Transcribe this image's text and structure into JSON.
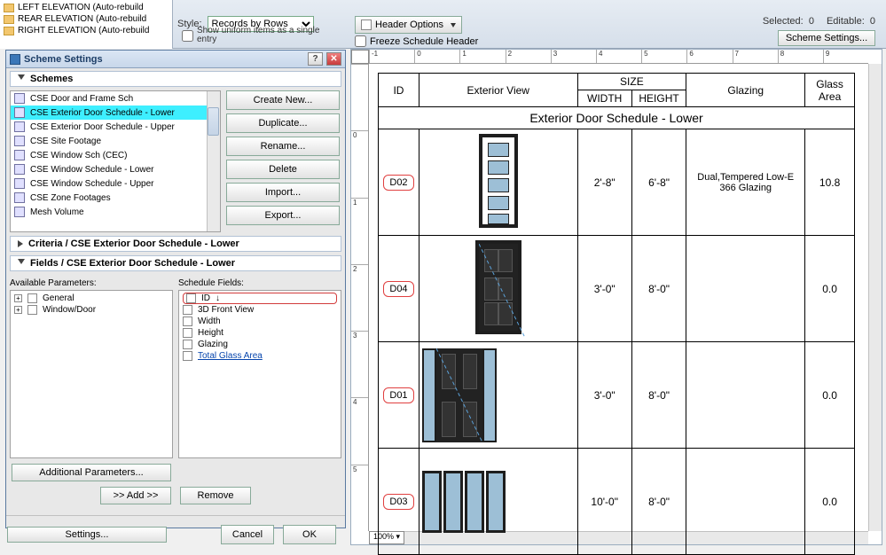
{
  "statusbar": {
    "selected_label": "Selected:",
    "selected": "0",
    "editable_label": "Editable:",
    "editable": "0"
  },
  "toolbar": {
    "style_label": "Style:",
    "style_value": "Records by Rows",
    "uniform_label": "Show uniform items as a single entry",
    "header_options": "Header Options",
    "freeze": "Freeze Schedule Header",
    "scheme_settings_btn": "Scheme Settings..."
  },
  "nav": {
    "items": [
      "LEFT ELEVATION (Auto-rebuild",
      "REAR ELEVATION (Auto-rebuild",
      "RIGHT ELEVATION (Auto-rebuild"
    ]
  },
  "modal": {
    "title": "Scheme Settings",
    "schemes_header": "Schemes",
    "buttons": {
      "create": "Create New...",
      "duplicate": "Duplicate...",
      "rename": "Rename...",
      "delete": "Delete",
      "import": "Import...",
      "export": "Export..."
    },
    "schemes": [
      "CSE Door and Frame Sch",
      "CSE Exterior Door Schedule - Lower",
      "CSE Exterior Door Schedule - Upper",
      "CSE Site Footage",
      "CSE Window Sch (CEC)",
      "CSE Window Schedule - Lower",
      "CSE Window Schedule - Upper",
      "CSE Zone Footages",
      "Mesh Volume"
    ],
    "criteria_header": "Criteria /  CSE Exterior Door Schedule - Lower",
    "fields_header": "Fields /  CSE Exterior Door Schedule - Lower",
    "avail_label": "Available Parameters:",
    "sched_label": "Schedule Fields:",
    "avail": [
      "General",
      "Window/Door"
    ],
    "fields": [
      "ID",
      "3D Front View",
      "Width",
      "Height",
      "Glazing",
      "Total Glass Area"
    ],
    "additional": "Additional Parameters...",
    "add": ">> Add >>",
    "remove": "Remove",
    "cancel": "Cancel",
    "ok": "OK",
    "settingsbtn": "Settings..."
  },
  "ruler": {
    "h": [
      "-1",
      "0",
      "1",
      "2",
      "3",
      "4",
      "5",
      "6",
      "7",
      "8",
      "9"
    ],
    "v": [
      "",
      "0",
      "1",
      "2",
      "3",
      "4",
      "5"
    ]
  },
  "zoom": "100%",
  "schedule": {
    "title": "Exterior Door Schedule - Lower",
    "cols": {
      "id": "ID",
      "view": "Exterior View",
      "size": "SIZE",
      "width": "WIDTH",
      "height": "HEIGHT",
      "glazing": "Glazing",
      "glass": "Glass Area"
    },
    "rows": [
      {
        "id": "D02",
        "w": "2'-8\"",
        "h": "6'-8\"",
        "glazing": "Dual,Tempered Low-E 366 Glazing",
        "glass": "10.8",
        "door": "glass"
      },
      {
        "id": "D04",
        "w": "3'-0\"",
        "h": "8'-0\"",
        "glazing": "",
        "glass": "0.0",
        "door": "panel"
      },
      {
        "id": "D01",
        "w": "3'-0\"",
        "h": "8'-0\"",
        "glazing": "",
        "glass": "0.0",
        "door": "panel_side"
      },
      {
        "id": "D03",
        "w": "10'-0\"",
        "h": "8'-0\"",
        "glazing": "",
        "glass": "0.0",
        "door": "slider"
      }
    ]
  }
}
